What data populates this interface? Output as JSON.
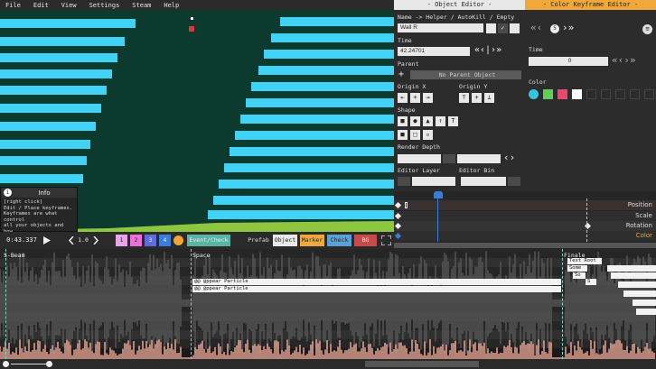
{
  "menu": [
    "File",
    "Edit",
    "View",
    "Settings",
    "Steam",
    "Help"
  ],
  "info": {
    "title": "Info",
    "icon": "info-icon",
    "text": "[right click]\nEdit / Place keyframes.\nKeyframes are what control\nall your objects and how\nthey act."
  },
  "timebar": {
    "time": "0:43.337",
    "pitch": "1.0",
    "layers": [
      "1",
      "2",
      "3",
      "4"
    ],
    "layer_colors": [
      "#e7a4e8",
      "#e773d8",
      "#5d6edc",
      "#3a7ddb"
    ],
    "event_check": "Event/Check",
    "modes": [
      "Prefab",
      "Object",
      "Marker",
      "Check",
      "BG"
    ]
  },
  "object_editor": {
    "header": "- Object Editor -",
    "name_label": "Name  ->  Helper / AutoKill / Empty",
    "name_value": "Wall R",
    "time_label": "Time",
    "time_value": "42.24701",
    "parent_label": "Parent",
    "parent_value": "No Parent Object",
    "origin_x_label": "Origin X",
    "origin_y_label": "Origin Y",
    "shape_label": "Shape",
    "render_depth_label": "Render Depth",
    "editor_layer_label": "Editor Layer",
    "editor_bin_label": "Editor Bin"
  },
  "keyframe_editor": {
    "header": "- Color Keyframe Editor -",
    "index": "5",
    "time_label": "Time",
    "time_value": "0",
    "color_label": "Color",
    "swatches": [
      "#34c6de",
      "#5fcf5a",
      "#e8486e",
      "#ffffff",
      "#2b2b2b",
      "#2b2b2b",
      "#2b2b2b",
      "#2b2b2b",
      "#2b2b2b"
    ]
  },
  "keyframe_tracks": [
    {
      "label": "Position",
      "color": "#e0e0e0"
    },
    {
      "label": "Scale",
      "color": "#e0e0e0"
    },
    {
      "label": "Rotation",
      "color": "#e0e0e0"
    },
    {
      "label": "Color",
      "color": "#f0a83a"
    }
  ],
  "markers": [
    "S-Beam",
    "Space",
    "Finale"
  ],
  "timeline_objects": [
    "@@ @ppear Particle",
    "@@ @ppear Particle"
  ],
  "text_objects": [
    "Text Root",
    "Some",
    "So",
    "S"
  ],
  "accent": "#f0a83a"
}
